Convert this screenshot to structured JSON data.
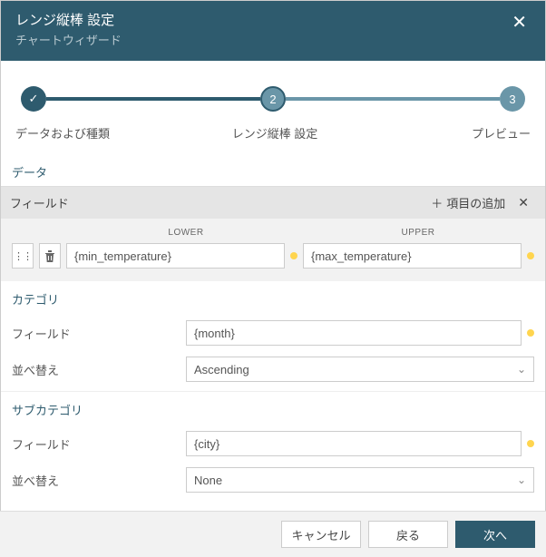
{
  "header": {
    "title": "レンジ縦棒 設定",
    "subtitle": "チャートウィザード"
  },
  "stepper": {
    "step2_num": "2",
    "step3_num": "3",
    "labels": {
      "s1": "データおよび種類",
      "s2": "レンジ縦棒 設定",
      "s3": "プレビュー"
    }
  },
  "data_section": {
    "title": "データ",
    "fields_label": "フィールド",
    "add_label": "項目の追加",
    "plus": "＋",
    "cols": {
      "lower": "LOWER",
      "upper": "UPPER"
    },
    "row": {
      "lower_value": "{min_temperature}",
      "upper_value": "{max_temperature}"
    }
  },
  "category": {
    "title": "カテゴリ",
    "field_label": "フィールド",
    "field_value": "{month}",
    "sort_label": "並べ替え",
    "sort_value": "Ascending"
  },
  "subcategory": {
    "title": "サブカテゴリ",
    "field_label": "フィールド",
    "field_value": "{city}",
    "sort_label": "並べ替え",
    "sort_value": "None"
  },
  "footer": {
    "cancel": "キャンセル",
    "back": "戻る",
    "next": "次へ"
  }
}
